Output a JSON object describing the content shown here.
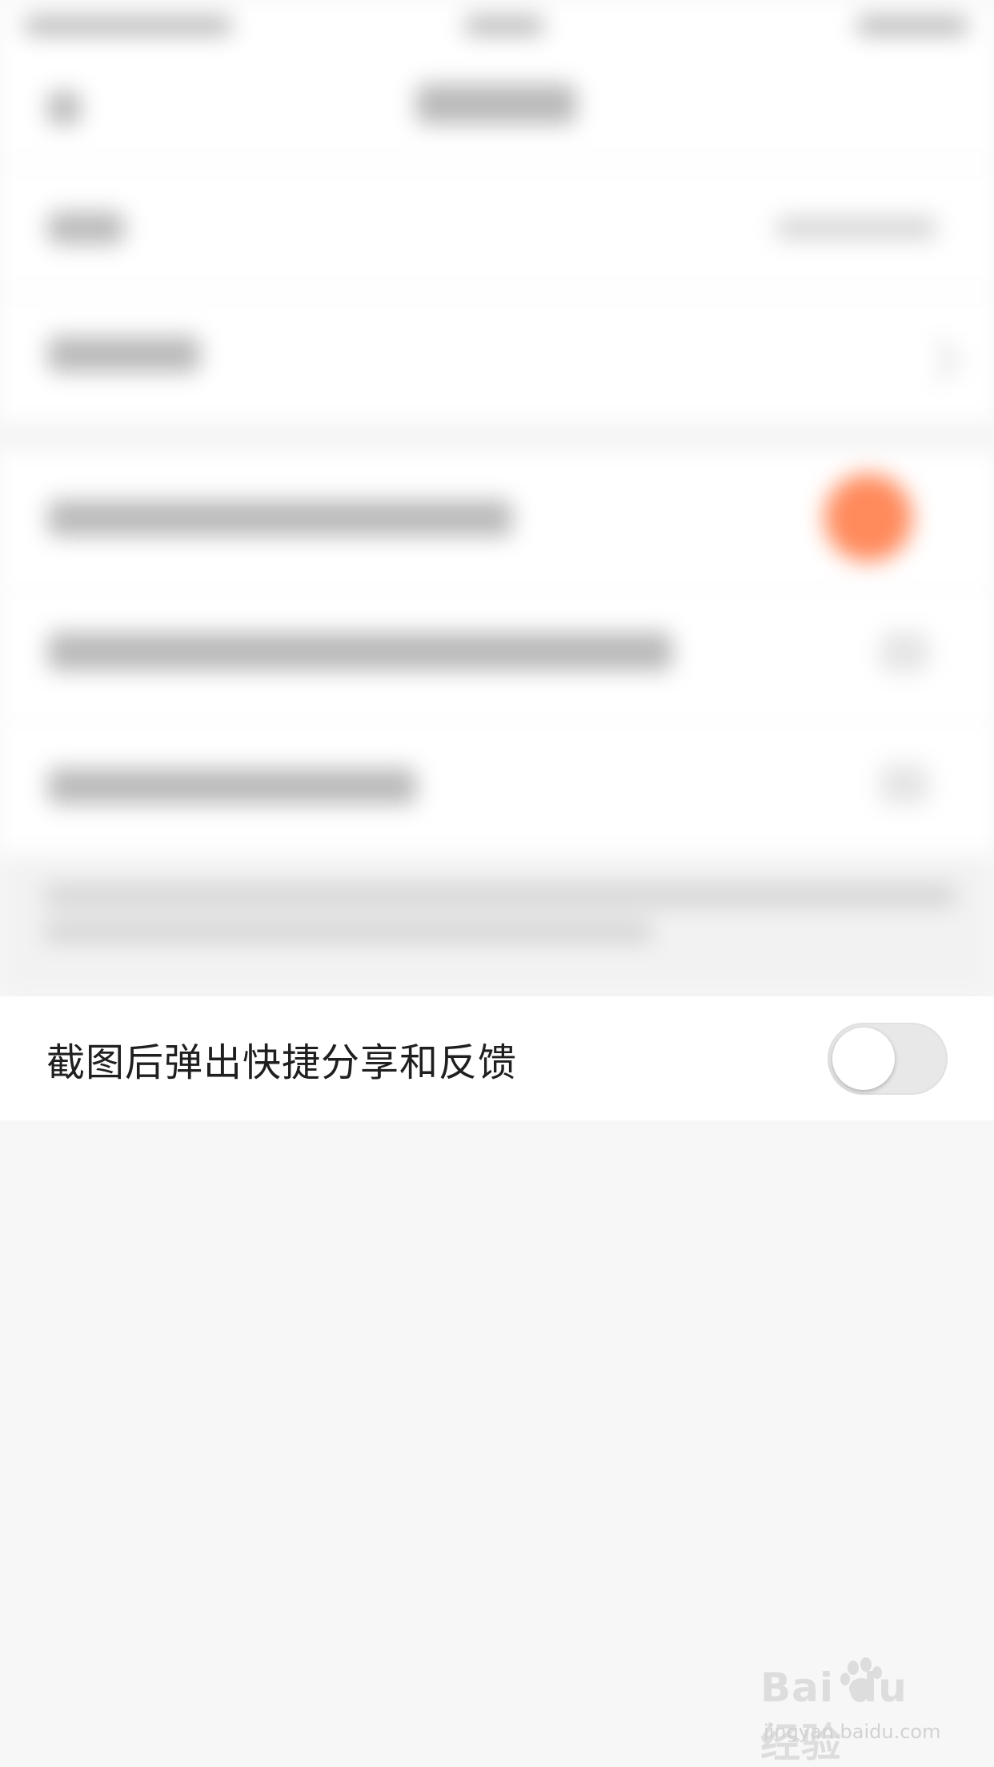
{
  "setting": {
    "label": "截图后弹出快捷分享和反馈",
    "toggle_state": "off"
  },
  "watermark": {
    "logo_text": "Bai du 经验",
    "url": "jingyan.baidu.com"
  },
  "colors": {
    "background": "#f7f7f7",
    "row_background": "#ffffff",
    "label_text": "#1f1f1f",
    "toggle_off_track": "#e8e8e8",
    "toggle_knob": "#ffffff",
    "blurred_accent": "#ff8a5c"
  }
}
